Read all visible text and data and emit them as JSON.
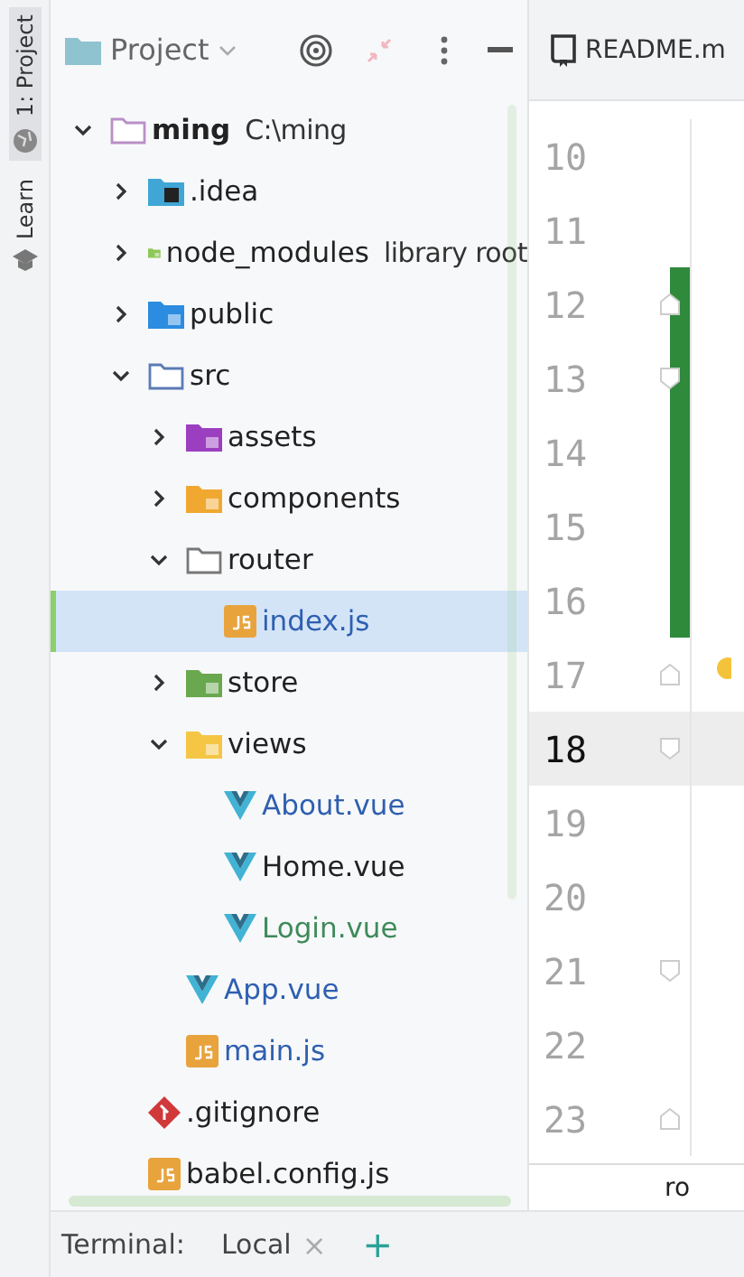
{
  "tool_strip": {
    "tabs": [
      {
        "label": "1: Project",
        "selected": true,
        "kind": "globe"
      },
      {
        "label": "Learn",
        "selected": false,
        "kind": "cap"
      }
    ]
  },
  "project_panel": {
    "title": "Project",
    "tree": [
      {
        "name": "ming",
        "hint": "C:\\ming",
        "kind": "root",
        "expanded": true,
        "selected": false,
        "color": "#222222",
        "children": [
          {
            "name": ".idea",
            "kind": "idea",
            "expanded": false,
            "selected": false,
            "color": "#222222"
          },
          {
            "name": "node_modules",
            "hint": "library root",
            "kind": "library",
            "expanded": false,
            "selected": false,
            "color": "#222222"
          },
          {
            "name": "public",
            "kind": "resources",
            "expanded": false,
            "selected": false,
            "color": "#222222"
          },
          {
            "name": "src",
            "kind": "source",
            "expanded": true,
            "selected": false,
            "color": "#222222",
            "children": [
              {
                "name": "assets",
                "kind": "assets",
                "expanded": false,
                "selected": false,
                "color": "#222222"
              },
              {
                "name": "components",
                "kind": "components",
                "expanded": false,
                "selected": false,
                "color": "#222222"
              },
              {
                "name": "router",
                "kind": "plain",
                "expanded": true,
                "selected": false,
                "color": "#222222",
                "children": [
                  {
                    "name": "index.js",
                    "kind": "js",
                    "selected": true,
                    "color": "#2e5fb0"
                  }
                ]
              },
              {
                "name": "store",
                "kind": "store",
                "expanded": false,
                "selected": false,
                "color": "#222222"
              },
              {
                "name": "views",
                "kind": "views",
                "expanded": true,
                "selected": false,
                "color": "#222222",
                "children": [
                  {
                    "name": "About.vue",
                    "kind": "vue",
                    "selected": false,
                    "color": "#2e5fb0"
                  },
                  {
                    "name": "Home.vue",
                    "kind": "vue",
                    "selected": false,
                    "color": "#222222"
                  },
                  {
                    "name": "Login.vue",
                    "kind": "vue",
                    "selected": false,
                    "color": "#3f8a5a"
                  }
                ]
              },
              {
                "name": "App.vue",
                "kind": "vue",
                "selected": false,
                "color": "#2e5fb0"
              },
              {
                "name": "main.js",
                "kind": "js",
                "selected": false,
                "color": "#2e5fb0"
              }
            ]
          },
          {
            "name": ".gitignore",
            "kind": "git",
            "selected": false,
            "color": "#222222"
          },
          {
            "name": "babel.config.js",
            "kind": "js",
            "selected": false,
            "color": "#222222"
          }
        ]
      }
    ]
  },
  "editor": {
    "tab": "README.m",
    "lines": [
      {
        "number": "10",
        "current": false,
        "changed": false,
        "fold_start": false,
        "fold_end": false
      },
      {
        "number": "11",
        "current": false,
        "changed": false,
        "fold_start": false,
        "fold_end": false
      },
      {
        "number": "12",
        "current": false,
        "changed": true,
        "fold_start": true,
        "fold_end": false
      },
      {
        "number": "13",
        "current": false,
        "changed": true,
        "fold_start": false,
        "fold_end": true
      },
      {
        "number": "14",
        "current": false,
        "changed": true,
        "fold_start": false,
        "fold_end": false
      },
      {
        "number": "15",
        "current": false,
        "changed": true,
        "fold_start": false,
        "fold_end": false
      },
      {
        "number": "16",
        "current": false,
        "changed": true,
        "fold_start": false,
        "fold_end": false
      },
      {
        "number": "17",
        "current": false,
        "changed": false,
        "fold_start": true,
        "fold_end": false,
        "bulb": true
      },
      {
        "number": "18",
        "current": true,
        "changed": false,
        "fold_start": false,
        "fold_end": true
      },
      {
        "number": "19",
        "current": false,
        "changed": false,
        "fold_start": false,
        "fold_end": false
      },
      {
        "number": "20",
        "current": false,
        "changed": false,
        "fold_start": false,
        "fold_end": false
      },
      {
        "number": "21",
        "current": false,
        "changed": false,
        "fold_start": false,
        "fold_end": true
      },
      {
        "number": "22",
        "current": false,
        "changed": false,
        "fold_start": false,
        "fold_end": false
      },
      {
        "number": "23",
        "current": false,
        "changed": false,
        "fold_start": true,
        "fold_end": false
      }
    ],
    "breadcrumb": "ro"
  },
  "terminal_bar": {
    "title": "Terminal:",
    "tabs": [
      {
        "label": "Local",
        "selected": true
      }
    ],
    "close": "×",
    "add": "+"
  }
}
